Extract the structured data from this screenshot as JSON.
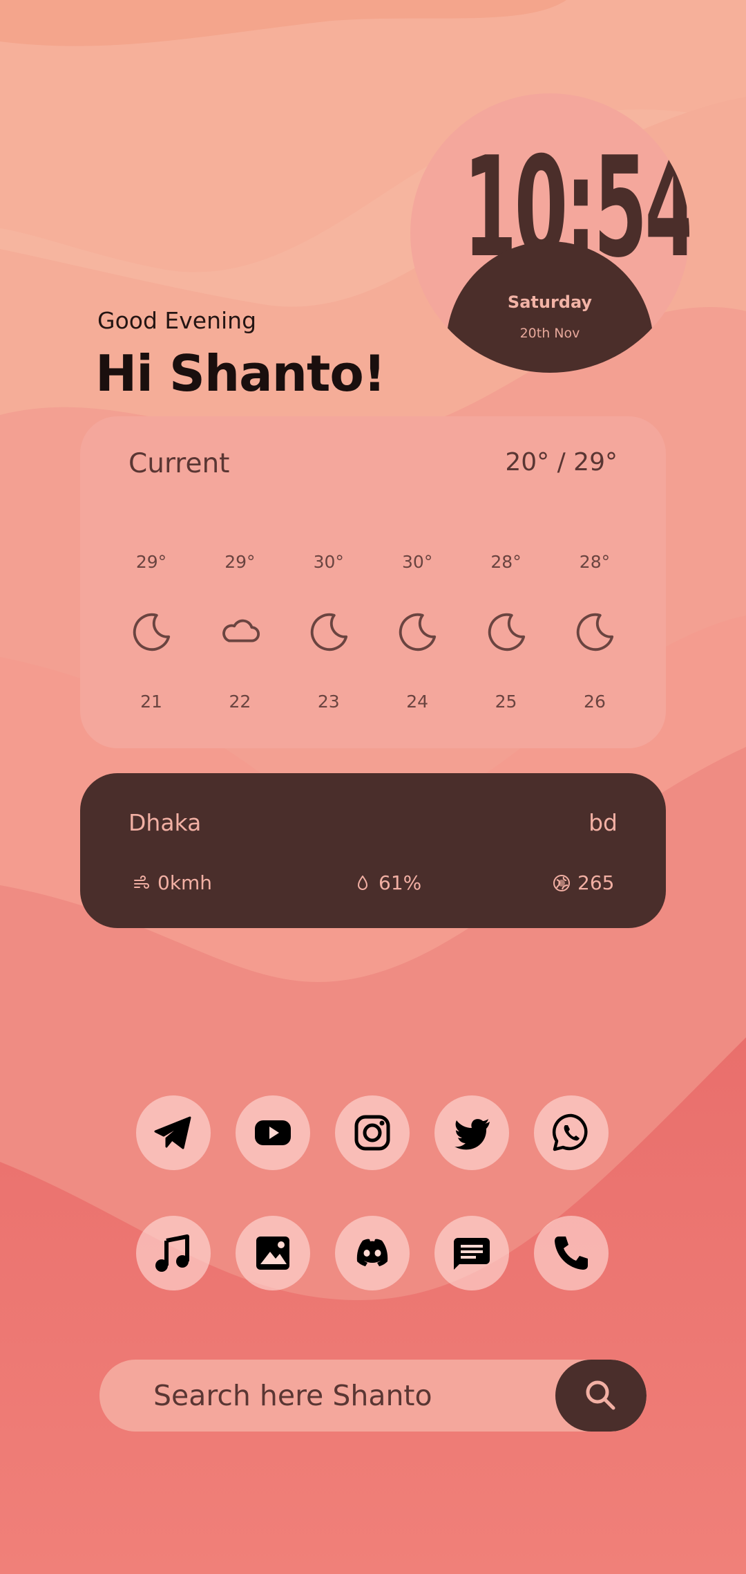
{
  "clock": {
    "time": "10:54",
    "day": "Saturday",
    "date": "20th Nov"
  },
  "greeting": {
    "subtitle": "Good Evening",
    "title": "Hi Shanto!"
  },
  "weather": {
    "current_label": "Current",
    "range": "20° / 29°",
    "forecast": [
      {
        "temp": "29°",
        "icon": "moon-icon",
        "hour": "21"
      },
      {
        "temp": "29°",
        "icon": "cloud-icon",
        "hour": "22"
      },
      {
        "temp": "30°",
        "icon": "moon-icon",
        "hour": "23"
      },
      {
        "temp": "30°",
        "icon": "moon-icon",
        "hour": "24"
      },
      {
        "temp": "28°",
        "icon": "moon-icon",
        "hour": "25"
      },
      {
        "temp": "28°",
        "icon": "moon-icon",
        "hour": "26"
      }
    ]
  },
  "city": {
    "name": "Dhaka",
    "country": "bd",
    "wind": "0kmh",
    "humidity": "61%",
    "aqi": "265"
  },
  "apps": {
    "row1": [
      "telegram-icon",
      "youtube-icon",
      "instagram-icon",
      "twitter-icon",
      "whatsapp-icon"
    ],
    "row2": [
      "music-icon",
      "gallery-icon",
      "discord-icon",
      "messages-icon",
      "phone-icon"
    ]
  },
  "search": {
    "placeholder": "Search here Shanto"
  },
  "colors": {
    "dark": "#4a2e2b",
    "card": "#f4a79c",
    "accent_text": "#f2b0a4"
  }
}
